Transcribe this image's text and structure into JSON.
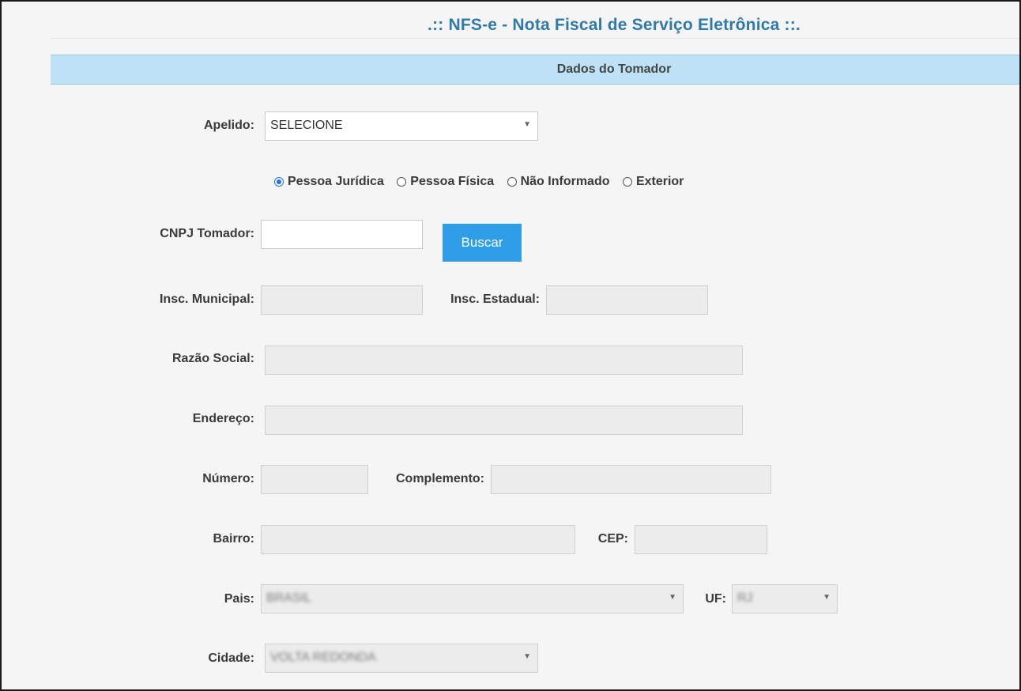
{
  "page": {
    "title": ".:: NFS-e - Nota Fiscal de Serviço Eletrônica ::.",
    "section_title": "Dados do Tomador"
  },
  "form": {
    "apelido": {
      "label": "Apelido:",
      "value": "SELECIONE"
    },
    "person_type": {
      "options": [
        "Pessoa Jurídica",
        "Pessoa Física",
        "Não Informado",
        "Exterior"
      ],
      "selected": "Pessoa Jurídica"
    },
    "cnpj": {
      "label": "CNPJ Tomador:",
      "value": ""
    },
    "buscar_label": "Buscar",
    "insc_municipal": {
      "label": "Insc. Municipal:",
      "value": ""
    },
    "insc_estadual": {
      "label": "Insc. Estadual:",
      "value": ""
    },
    "razao_social": {
      "label": "Razão Social:",
      "value": ""
    },
    "endereco": {
      "label": "Endereço:",
      "value": ""
    },
    "numero": {
      "label": "Número:",
      "value": ""
    },
    "complemento": {
      "label": "Complemento:",
      "value": ""
    },
    "bairro": {
      "label": "Bairro:",
      "value": ""
    },
    "cep": {
      "label": "CEP:",
      "value": ""
    },
    "pais": {
      "label": "Pais:",
      "value": "BRASIL"
    },
    "uf": {
      "label": "UF:",
      "value": "RJ"
    },
    "cidade": {
      "label": "Cidade:",
      "value": "VOLTA REDONDA"
    }
  },
  "colors": {
    "title": "#2f7aa8",
    "header_bg": "#bde2f6",
    "button_bg": "#2e9ee6",
    "radio_accent": "#1a73e8"
  }
}
